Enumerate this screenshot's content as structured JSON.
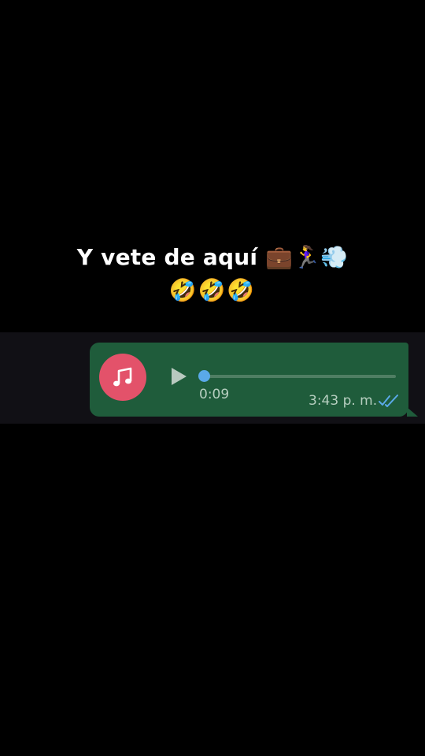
{
  "caption": {
    "line1": "Y vete de aquí 💼🏃‍♀️💨",
    "line2": "🤣🤣🤣"
  },
  "voice_message": {
    "icon": "music-note-icon",
    "avatar_color": "#e3526a",
    "bubble_color": "#1f5c3b",
    "progress": 0,
    "duration": "0:09",
    "timestamp": "3:43 p. m.",
    "status_icon": "double-check-read-icon",
    "status_color": "#5aa9e8"
  }
}
